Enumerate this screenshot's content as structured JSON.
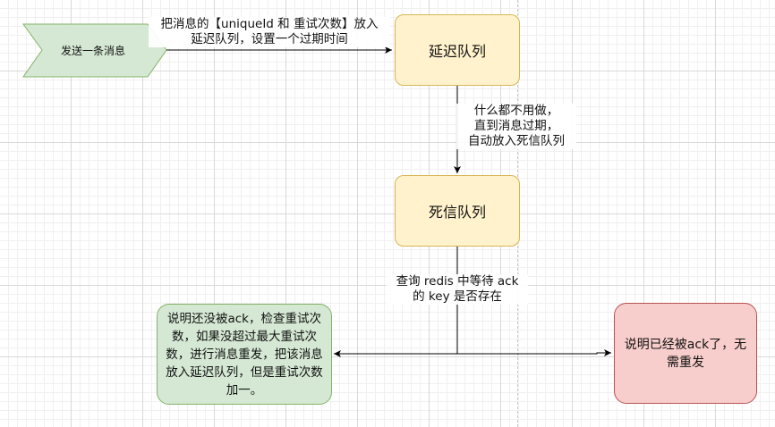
{
  "start": {
    "label": "发送一条消息"
  },
  "edges": {
    "start_to_delay": "把消息的【uniqueId 和 重试次数】放入\n延迟队列，设置一个过期时间",
    "delay_to_dead": "什么都不用做，\n直到消息过期，\n自动放入死信队列",
    "dead_to_branch": "查询 redis 中等待 ack\n的 key 是否存在"
  },
  "nodes": {
    "delay_queue": "延迟队列",
    "dead_letter_queue": "死信队列",
    "not_acked": "说明还没被ack，检查重试次数，如果没超过最大重试次数，进行消息重发，把该消息放入延迟队列，但是重试次数加一。",
    "acked": "说明已经被ack了，无需重发"
  },
  "colors": {
    "yellow_fill": "#fff2cc",
    "yellow_stroke": "#d6b656",
    "green_fill": "#d5e8d4",
    "green_stroke": "#82b366",
    "red_fill": "#f8cecc",
    "red_stroke": "#b85450"
  }
}
